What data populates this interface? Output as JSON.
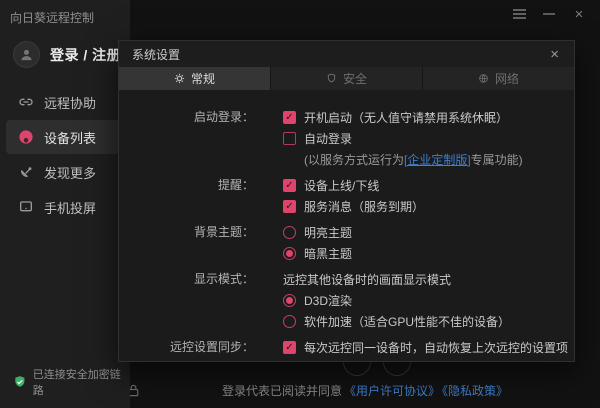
{
  "icons": {
    "check": "✓",
    "close": "×"
  },
  "colors": {
    "accent": "#e0436b",
    "link": "#3f7fd0",
    "success": "#3fae68",
    "dialog_bg": "#1b1b1b",
    "sidebar_bg": "#1f1f1f"
  },
  "titlebar": {
    "app_title": "向日葵远程控制"
  },
  "sidebar": {
    "login_label": "登录 / 注册",
    "items": [
      {
        "label": "远程协助",
        "active": false
      },
      {
        "label": "设备列表",
        "active": true
      },
      {
        "label": "发现更多",
        "active": false
      },
      {
        "label": "手机投屏",
        "active": false
      }
    ],
    "status_text": "已连接安全加密链路"
  },
  "footer": {
    "agreement_text": "登录代表已阅读并同意",
    "license_link": "《用户许可协议》",
    "privacy_link": "《隐私政策》"
  },
  "dialog": {
    "title": "系统设置",
    "tabs": [
      {
        "label": "常规",
        "active": true
      },
      {
        "label": "安全",
        "active": false
      },
      {
        "label": "网络",
        "active": false
      }
    ],
    "sections": [
      {
        "label": "启动登录：",
        "items": [
          {
            "type": "checkbox",
            "checked": true,
            "text": "开机启动（无人值守请禁用系统休眠）"
          },
          {
            "type": "checkbox",
            "checked": false,
            "text": "自动登录"
          },
          {
            "type": "note",
            "prefix": "(以服务方式运行为",
            "link": "[企业定制版]",
            "suffix": "专属功能)"
          }
        ]
      },
      {
        "label": "提醒：",
        "items": [
          {
            "type": "checkbox",
            "checked": true,
            "text": "设备上线/下线"
          },
          {
            "type": "checkbox",
            "checked": true,
            "text": "服务消息（服务到期）"
          }
        ]
      },
      {
        "label": "背景主题：",
        "items": [
          {
            "type": "radio",
            "checked": false,
            "text": "明亮主题"
          },
          {
            "type": "radio",
            "checked": true,
            "text": "暗黑主题"
          }
        ]
      },
      {
        "label": "显示模式：",
        "items": [
          {
            "type": "text",
            "text": "远控其他设备时的画面显示模式"
          },
          {
            "type": "radio",
            "checked": true,
            "text": "D3D渲染"
          },
          {
            "type": "radio",
            "checked": false,
            "text": "软件加速（适合GPU性能不佳的设备）"
          }
        ]
      },
      {
        "label": "远控设置同步：",
        "items": [
          {
            "type": "checkbox",
            "checked": true,
            "text": "每次远控同一设备时，自动恢复上次远控的设置项"
          }
        ]
      }
    ]
  }
}
